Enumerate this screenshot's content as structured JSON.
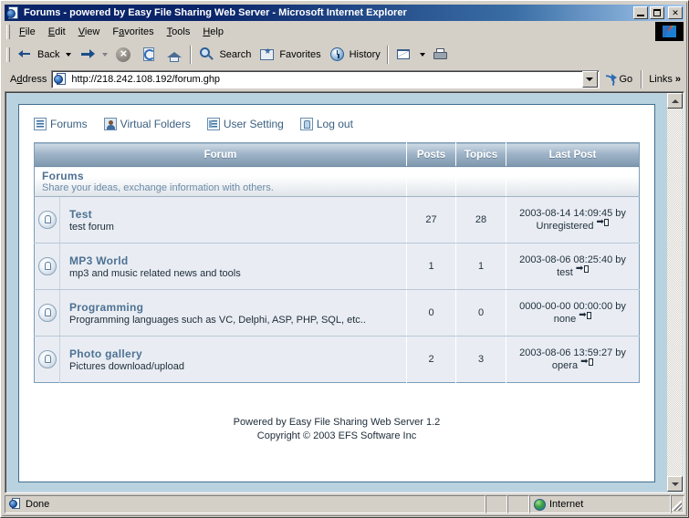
{
  "window": {
    "title": "Forums - powered by Easy File Sharing Web Server - Microsoft Internet Explorer",
    "title_icon": "page-globe-icon",
    "minimize_label": "_",
    "maximize_label": "□",
    "close_label": "×"
  },
  "menu": {
    "items": [
      {
        "label": "File"
      },
      {
        "label": "Edit"
      },
      {
        "label": "View"
      },
      {
        "label": "Favorites"
      },
      {
        "label": "Tools"
      },
      {
        "label": "Help"
      }
    ]
  },
  "toolbar": {
    "back_label": "Back",
    "forward_label": "",
    "stop_label": "",
    "refresh_label": "",
    "home_label": "",
    "search_label": "Search",
    "favorites_label": "Favorites",
    "history_label": "History",
    "mail_label": "",
    "print_label": ""
  },
  "address": {
    "label": "Address",
    "url": "http://218.242.108.192/forum.ghp",
    "go_label": "Go",
    "links_label": "Links",
    "links_chevron": "»"
  },
  "nav": {
    "items": [
      {
        "label": "Forums",
        "icon": "list-icon"
      },
      {
        "label": "Virtual Folders",
        "icon": "person-icon"
      },
      {
        "label": "User Setting",
        "icon": "setting-icon"
      },
      {
        "label": "Log out",
        "icon": "logout-icon"
      }
    ]
  },
  "table": {
    "headers": [
      "Forum",
      "Posts",
      "Topics",
      "Last Post"
    ],
    "category": {
      "title": "Forums",
      "description": "Share your ideas, exchange information with others."
    },
    "rows": [
      {
        "name": "Test",
        "description": "test forum",
        "posts": "27",
        "topics": "28",
        "last_post_date": "2003-08-14 14:09:45 by",
        "last_post_user": "Unregistered"
      },
      {
        "name": "MP3 World",
        "description": "mp3 and music related news and tools",
        "posts": "1",
        "topics": "1",
        "last_post_date": "2003-08-06 08:25:40 by",
        "last_post_user": "test"
      },
      {
        "name": "Programming",
        "description": "Programming languages such as VC, Delphi, ASP, PHP, SQL, etc..",
        "posts": "0",
        "topics": "0",
        "last_post_date": "0000-00-00 00:00:00 by",
        "last_post_user": "none"
      },
      {
        "name": "Photo gallery",
        "description": "Pictures download/upload",
        "posts": "2",
        "topics": "3",
        "last_post_date": "2003-08-06 13:59:27 by",
        "last_post_user": "opera"
      }
    ]
  },
  "footer": {
    "line1": "Powered by Easy File Sharing Web Server 1.2",
    "line2": "Copyright © 2003 EFS Software Inc"
  },
  "statusbar": {
    "status": "Done",
    "zone": "Internet"
  },
  "colors": {
    "titlebar_start": "#0a246a",
    "titlebar_end": "#a6caf0",
    "chrome": "#d4d0c8",
    "page_bg": "#b9d2e0",
    "link_blue": "#4d7193",
    "header_blue": "#7e97ad",
    "row_bg": "#e9edf3"
  }
}
